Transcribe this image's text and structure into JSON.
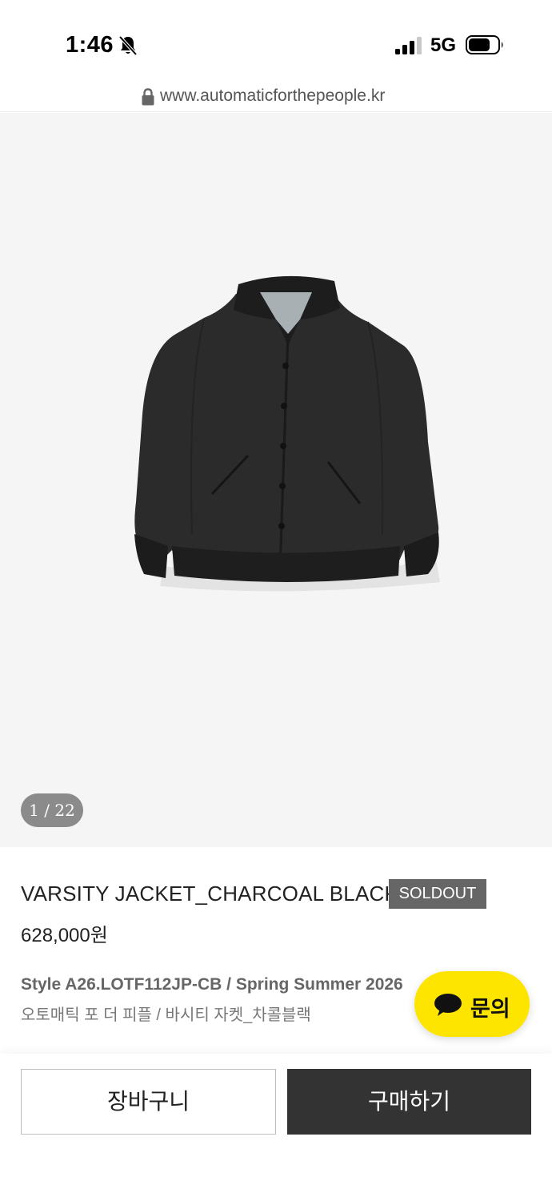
{
  "status_bar": {
    "time": "1:46",
    "network": "5G",
    "icons": [
      "bell-slash-icon",
      "signal-icon",
      "battery-icon"
    ]
  },
  "browser": {
    "url": "www.automaticforthepeople.kr",
    "icons": [
      "lock-icon"
    ]
  },
  "gallery": {
    "counter": "1 / 22",
    "image": "charcoal-black-varsity-jacket-image"
  },
  "product": {
    "name": "VARSITY JACKET_CHARCOAL BLACK",
    "badge": "SOLDOUT",
    "price": "628,000원",
    "style_line": "Style A26.LOTF112JP-CB / Spring Summer 2026",
    "subtitle": "오토매틱 포 더 피플 / 바시티 자켓_차콜블랙"
  },
  "chat": {
    "label": "문의",
    "icon": "speech-bubble-icon",
    "color": "#fee500"
  },
  "actions": {
    "cart_label": "장바구니",
    "buy_label": "구매하기",
    "buy_color": "#333333"
  }
}
